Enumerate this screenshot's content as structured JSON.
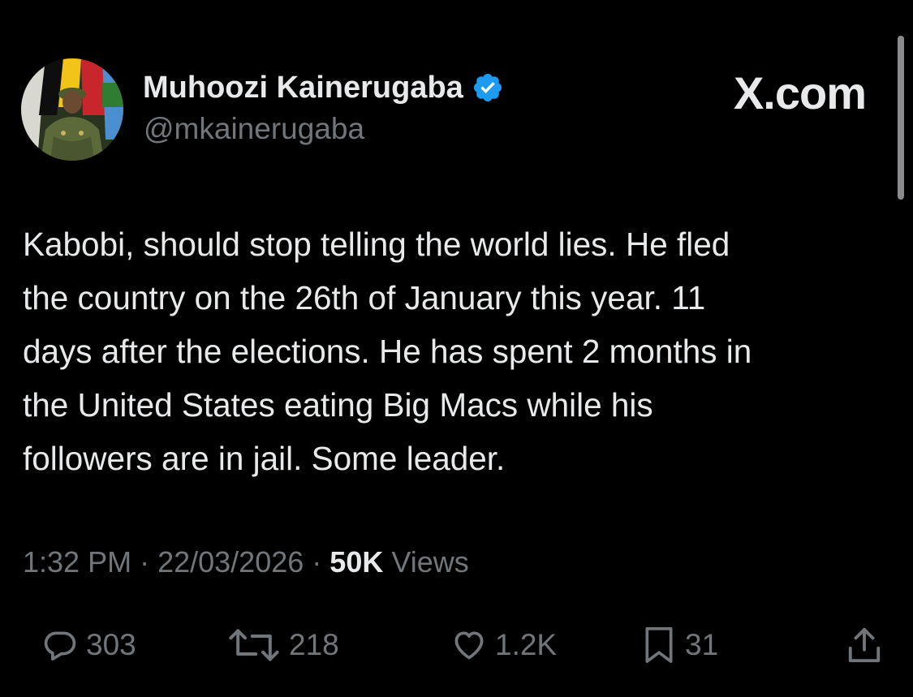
{
  "author": {
    "name": "Muhoozi Kainerugaba",
    "handle": "@mkainerugaba",
    "verified": true
  },
  "brand": "X.com",
  "tweet": {
    "lines": [
      "Kabobi, should stop telling the world lies. He fled",
      "the country on the 26th of January this year. 11",
      "days after the elections. He has spent 2 months in",
      "the United States eating Big Macs while his",
      "followers are in jail. Some leader."
    ]
  },
  "meta": {
    "time": "1:32 PM",
    "date": "22/03/2026",
    "separator": "·",
    "views_count": "50K",
    "views_label": "Views"
  },
  "actions": {
    "replies": {
      "icon": "reply-icon",
      "count": "303"
    },
    "reposts": {
      "icon": "repost-icon",
      "count": "218"
    },
    "likes": {
      "icon": "heart-icon",
      "count": "1.2K"
    },
    "bookmarks": {
      "icon": "bookmark-icon",
      "count": "31"
    },
    "share": {
      "icon": "share-icon"
    }
  },
  "colors": {
    "background": "#000000",
    "text": "#e7e9ea",
    "secondary": "#71767b",
    "verified": "#1d9bf0"
  }
}
